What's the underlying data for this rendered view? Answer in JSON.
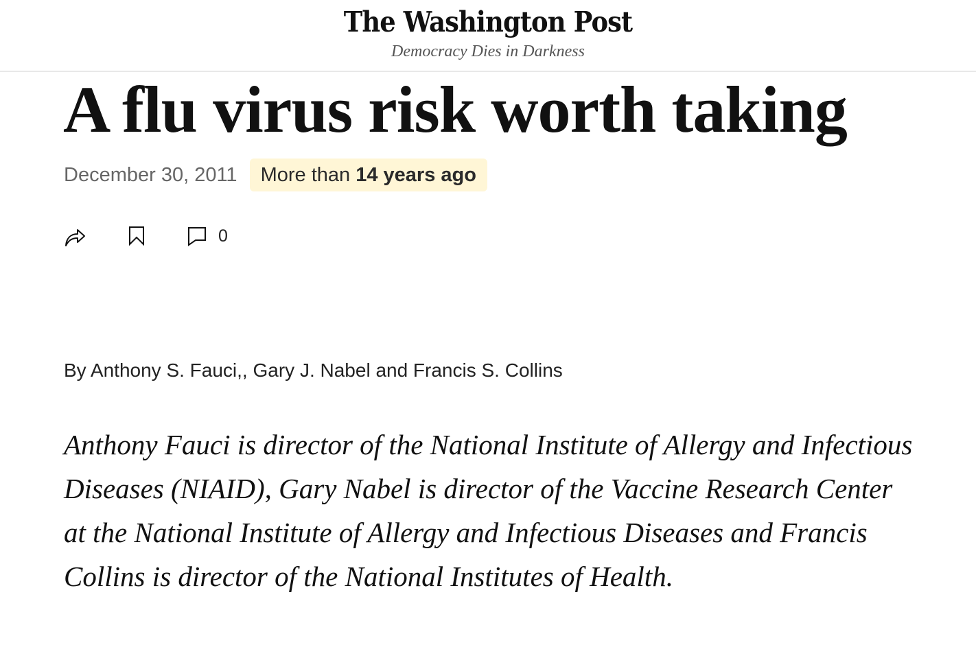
{
  "masthead": {
    "logo_text": "The Washington Post",
    "tagline": "Democracy Dies in Darkness"
  },
  "article": {
    "headline": "A flu virus risk worth taking",
    "date": "December 30, 2011",
    "age_prefix": "More than",
    "age_value": "14 years ago",
    "actions": {
      "share_icon": "share-icon",
      "bookmark_icon": "bookmark-icon",
      "comment_icon": "comment-icon",
      "comment_count": "0"
    },
    "byline": {
      "prefix": "By",
      "authors": "Anthony S. Fauci,, Gary J. Nabel and Francis S. Collins"
    },
    "bio": "Anthony Fauci is director of the National Institute of Allergy and Infectious Diseases (NIAID), Gary Nabel is director of the Vaccine Research Center at the National Institute of Allergy and Infectious Diseases and Francis Collins is director of the National Institutes of Health."
  }
}
